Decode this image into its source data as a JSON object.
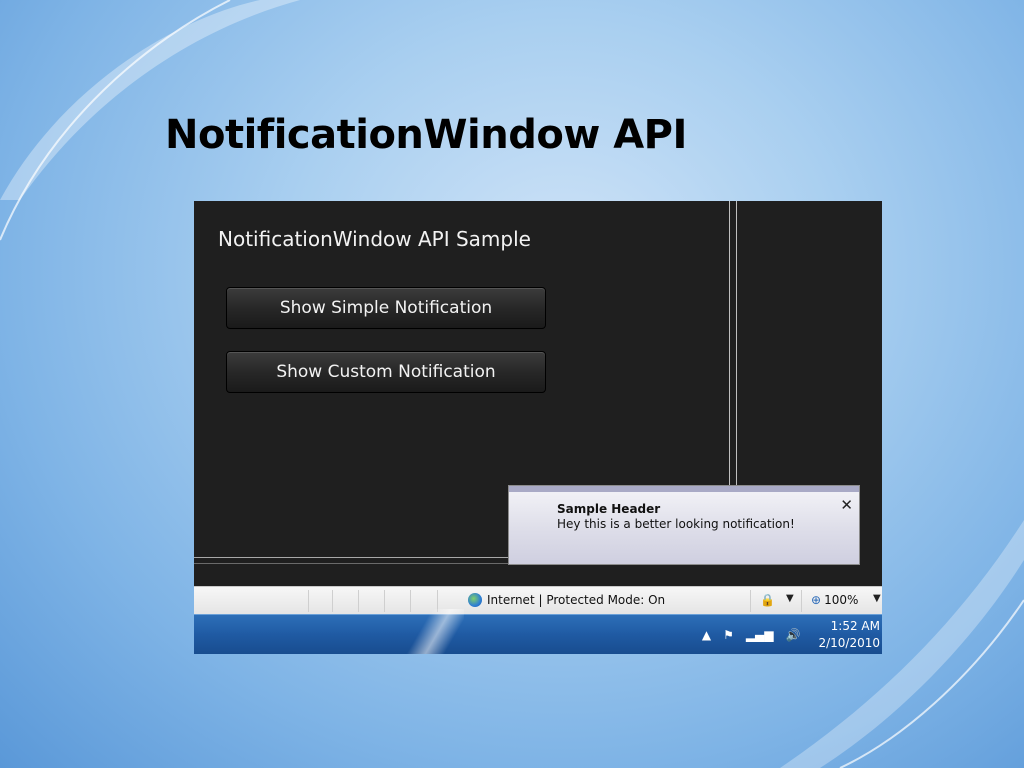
{
  "slide": {
    "title": "NotificationWindow API"
  },
  "app": {
    "title": "NotificationWindow API Sample",
    "buttons": {
      "simple": "Show Simple Notification",
      "custom": "Show Custom Notification"
    }
  },
  "notification": {
    "header": "Sample Header",
    "message": "Hey this is a better looking notification!",
    "close_glyph": "✕"
  },
  "statusbar": {
    "zone_text": "Internet | Protected Mode: On",
    "zoom": "100%",
    "zone_icon": "globe-icon",
    "security_icon": "lock-icon"
  },
  "taskbar": {
    "time": "1:52 AM",
    "date": "2/10/2010",
    "tray_icons": [
      "show-hidden-icons-icon",
      "action-center-flag-icon",
      "network-signal-icon",
      "volume-icon"
    ]
  },
  "colors": {
    "app_background": "#1f1f1f",
    "taskbar": "#1f5aa3",
    "slide_background": "#a9cff0"
  }
}
